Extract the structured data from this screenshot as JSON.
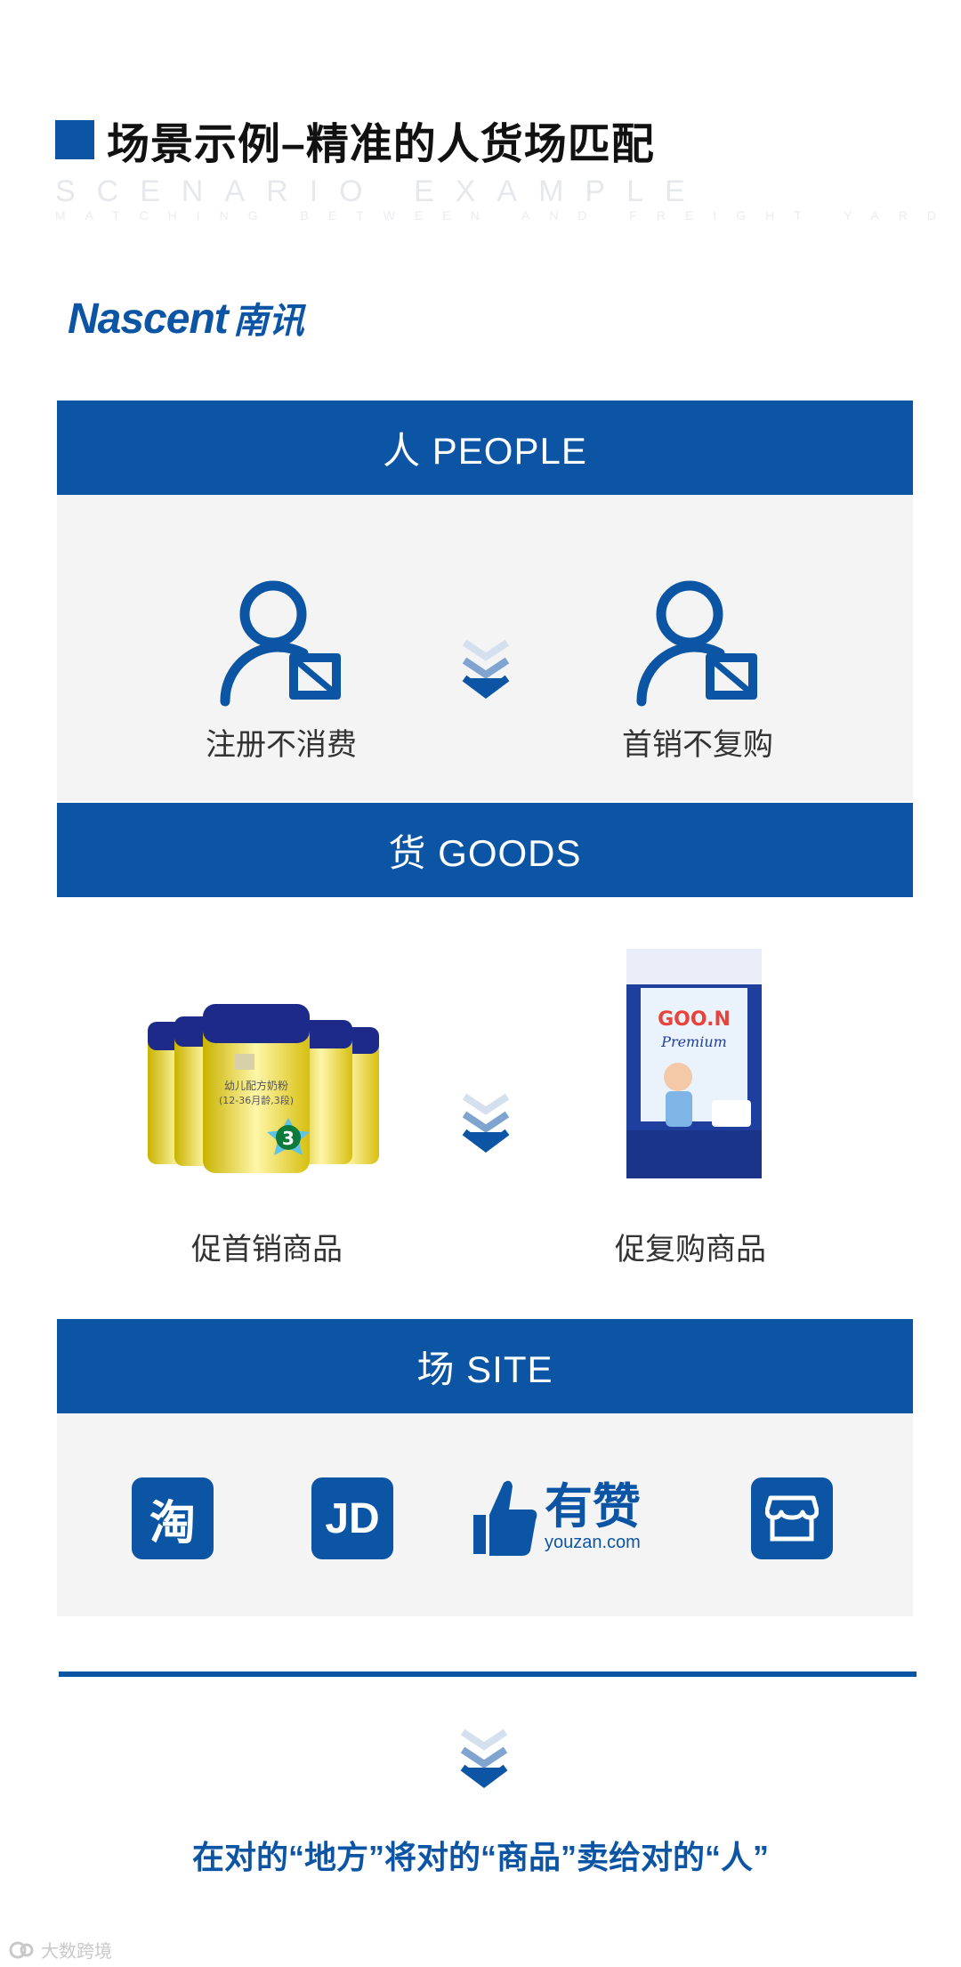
{
  "header": {
    "title": "场景示例–精准的人货场匹配",
    "subtitle_en": "SCENARIO EXAMPLE",
    "subtitle_small": "MATCHING BETWEEN AND FREIGHT YARD"
  },
  "logo": {
    "latin_1": "Na",
    "latin_2": "scent",
    "chinese": "南讯"
  },
  "people": {
    "band_label": "人 PEOPLE",
    "left_caption": "注册不消费",
    "right_caption": "首销不复购",
    "icon": "user-blocked-icon"
  },
  "goods": {
    "band_label": "货 GOODS",
    "left_caption": "促首销商品",
    "right_caption": "促复购商品",
    "can_label_line1": "幼儿配方奶粉",
    "can_label_line2": "(12-36月龄,3段)",
    "can_stage": "3",
    "diaper_brand": "GOO.N",
    "diaper_sub": "Premium"
  },
  "site": {
    "band_label": "场 SITE",
    "taobao_glyph": "淘",
    "jd_glyph": "JD",
    "youzan_name": "有赞",
    "youzan_domain": "youzan.com",
    "store_icon": "storefront-icon"
  },
  "footer": {
    "slogan": "在对的“地方”将对的“商品”卖给对的“人”",
    "watermark": "大数跨境"
  },
  "colors": {
    "brand_blue": "#0c55a5",
    "panel_gray": "#f4f4f5"
  }
}
